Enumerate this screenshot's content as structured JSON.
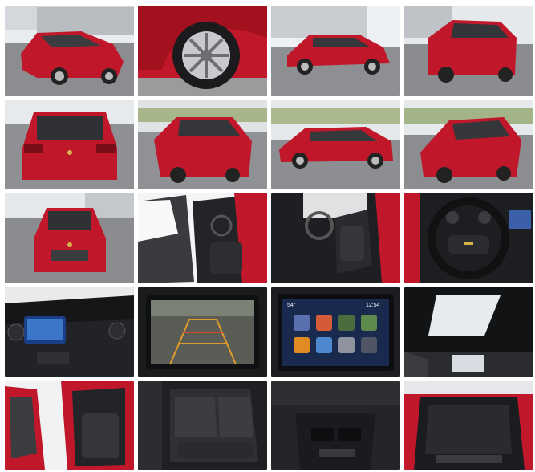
{
  "gallery": {
    "title": "",
    "photos": [
      {
        "name": "front-quarter-exterior"
      },
      {
        "name": "wheel-closeup"
      },
      {
        "name": "side-profile-exterior"
      },
      {
        "name": "rear-quarter-exterior"
      },
      {
        "name": "rear-exterior"
      },
      {
        "name": "rear-quarter-exterior-2"
      },
      {
        "name": "side-profile-exterior-2"
      },
      {
        "name": "front-quarter-exterior-2"
      },
      {
        "name": "front-exterior"
      },
      {
        "name": "driver-door-open"
      },
      {
        "name": "driver-interior"
      },
      {
        "name": "steering-wheel-dashboard"
      },
      {
        "name": "center-console-dashboard"
      },
      {
        "name": "backup-camera-screen"
      },
      {
        "name": "infotainment-home-screen"
      },
      {
        "name": "sunroof-headliner"
      },
      {
        "name": "rear-door-open"
      },
      {
        "name": "rear-seats"
      },
      {
        "name": "rear-console-vents"
      },
      {
        "name": "cargo-area"
      }
    ],
    "screen_text": {
      "temp": "54°",
      "clock": "12:54"
    },
    "colors": {
      "car_red": "#c0182a",
      "dark_interior": "#1e1f22",
      "asphalt": "#8b8d90",
      "sky": "#e9edf0"
    }
  }
}
